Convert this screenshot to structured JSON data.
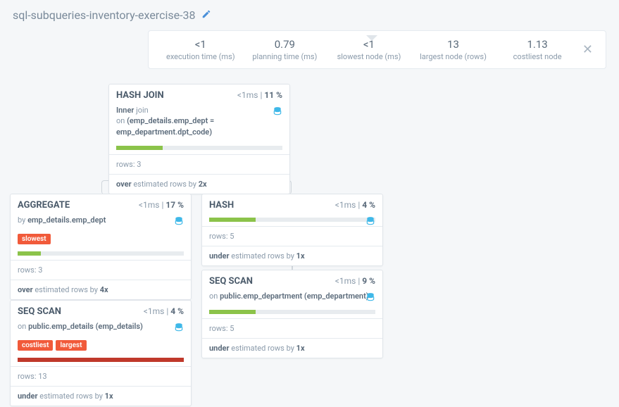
{
  "header": {
    "title": "sql-subqueries-inventory-exercise-38"
  },
  "stats": {
    "execution_time": {
      "value": "<1",
      "label": "execution time (ms)"
    },
    "planning_time": {
      "value": "0.79",
      "label": "planning time (ms)"
    },
    "slowest_node": {
      "value": "<1",
      "label": "slowest node (ms)"
    },
    "largest_node": {
      "value": "13",
      "label": "largest node (rows)"
    },
    "costliest_node": {
      "value": "1.13",
      "label": "costliest node"
    }
  },
  "nodes": {
    "hash_join": {
      "title": "HASH JOIN",
      "time": "<1ms",
      "pct": "11 %",
      "detail_k1": "Inner",
      "detail_t1": "join",
      "detail_t2": "on",
      "detail_v2": "(emp_details.emp_dept = emp_department.dpt_code)",
      "rows": "rows: 3",
      "est_prefix": "over",
      "est_mid": "estimated rows by",
      "est_mult": "2x",
      "bar_pct": 28
    },
    "aggregate": {
      "title": "AGGREGATE",
      "time": "<1ms",
      "pct": "17 %",
      "detail_t1": "by",
      "detail_v1": "emp_details.emp_dept",
      "badges": [
        "slowest"
      ],
      "rows": "rows: 3",
      "est_prefix": "over",
      "est_mid": "estimated rows by",
      "est_mult": "4x",
      "bar_pct": 14
    },
    "seq_scan_left": {
      "title": "SEQ SCAN",
      "time": "<1ms",
      "pct": "4 %",
      "detail_t1": "on",
      "detail_v1": "public.emp_details (emp_details)",
      "badges": [
        "costliest",
        "largest"
      ],
      "rows": "rows: 13",
      "est_prefix": "under",
      "est_mid": "estimated rows by",
      "est_mult": "1x",
      "bar_pct": 100,
      "bar_color": "red"
    },
    "hash": {
      "title": "HASH",
      "time": "<1ms",
      "pct": "4 %",
      "rows": "rows: 5",
      "est_prefix": "under",
      "est_mid": "estimated rows by",
      "est_mult": "1x",
      "bar_pct": 28
    },
    "seq_scan_right": {
      "title": "SEQ SCAN",
      "time": "<1ms",
      "pct": "9 %",
      "detail_t1": "on",
      "detail_v1": "public.emp_department (emp_department)",
      "rows": "rows: 5",
      "est_prefix": "under",
      "est_mid": "estimated rows by",
      "est_mult": "1x",
      "bar_pct": 28
    }
  }
}
